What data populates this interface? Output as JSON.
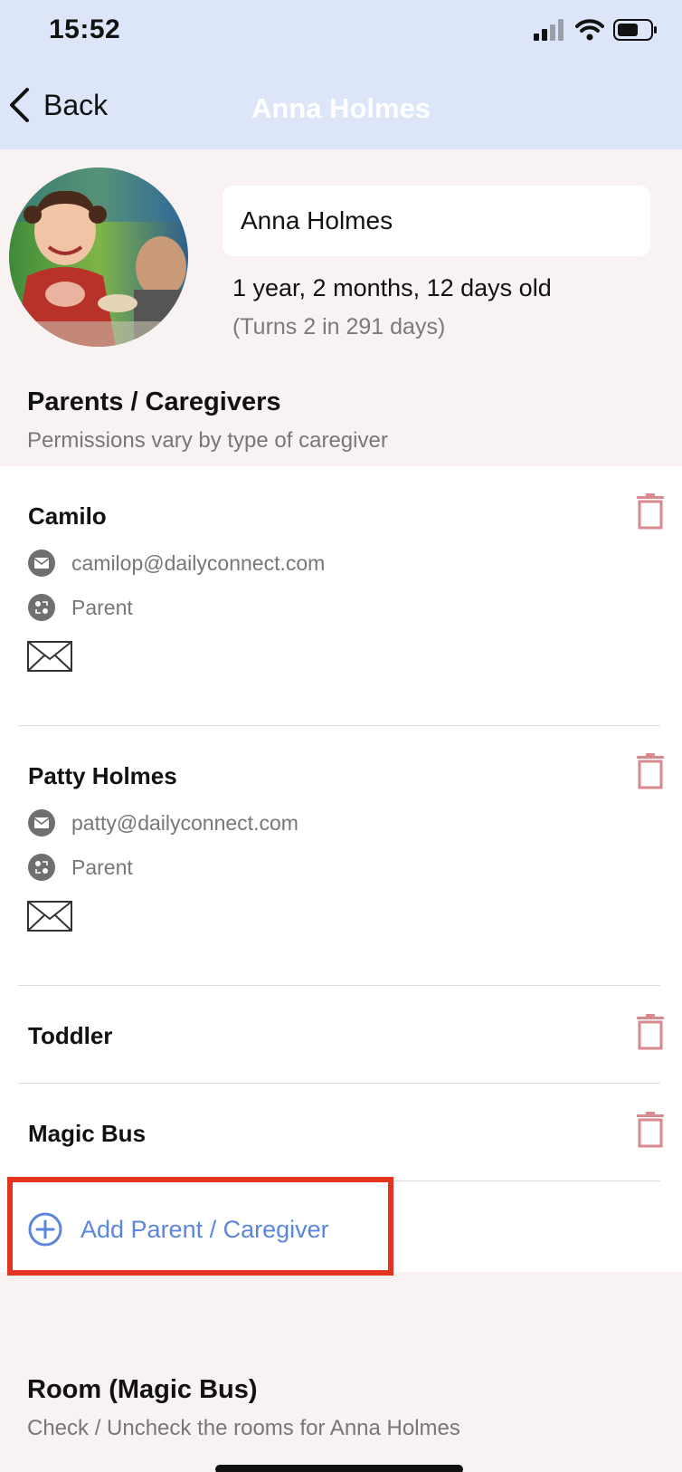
{
  "status_bar": {
    "time": "15:52"
  },
  "nav": {
    "back_label": "Back",
    "title": "Anna Holmes"
  },
  "profile": {
    "name": "Anna Holmes",
    "age": "1 year, 2 months, 12 days old",
    "turns": "(Turns 2 in 291 days)"
  },
  "parents_section": {
    "title": "Parents / Caregivers",
    "subtitle": "Permissions vary by type of caregiver"
  },
  "caregivers": [
    {
      "name": "Camilo",
      "email": "camilop@dailyconnect.com",
      "role": "Parent"
    },
    {
      "name": "Patty Holmes",
      "email": "patty@dailyconnect.com",
      "role": "Parent"
    },
    {
      "name": "Toddler"
    },
    {
      "name": "Magic Bus"
    }
  ],
  "add_caregiver": {
    "label": "Add Parent / Caregiver"
  },
  "room_section": {
    "title": "Room (Magic Bus)",
    "subtitle": "Check / Uncheck the rooms for Anna Holmes"
  },
  "colors": {
    "nav_bg": "#dde6f8",
    "page_bg": "#f8f3f2",
    "trash": "#d98a8f",
    "accent_blue": "#5b86de",
    "highlight_red": "#e2341f"
  },
  "icons": {
    "back": "chevron-left-icon",
    "email": "envelope-icon",
    "role": "people-swap-icon",
    "mail": "mail-outline-icon",
    "delete": "trash-icon",
    "add": "plus-circle-icon"
  }
}
